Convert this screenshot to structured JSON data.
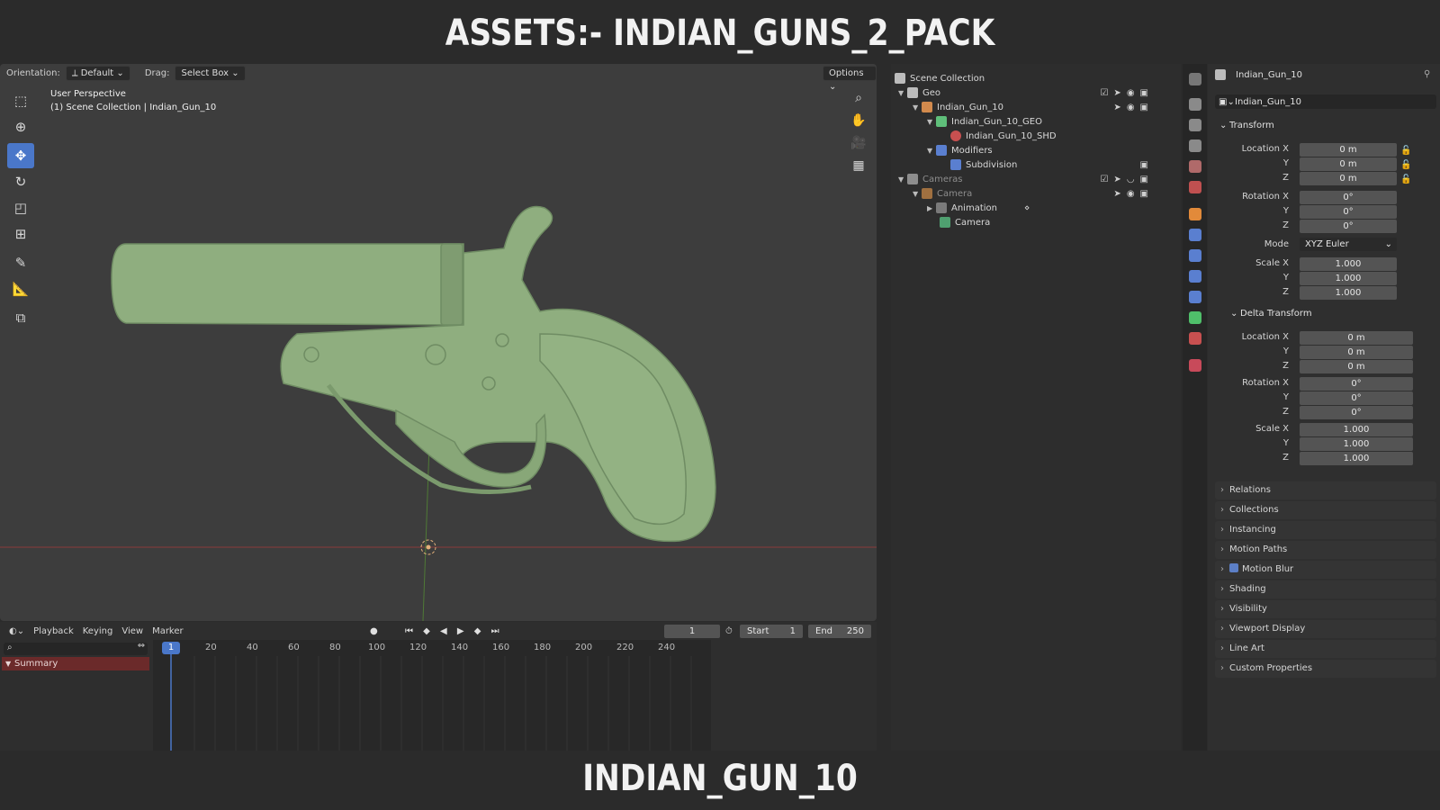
{
  "banner": {
    "top": "ASSETS:- INDIAN_GUNS_2_PACK",
    "bottom": "INDIAN_GUN_10"
  },
  "viewport": {
    "orientation_label": "Orientation:",
    "orientation_value": "Default",
    "drag_label": "Drag:",
    "drag_value": "Select Box",
    "options_label": "Options",
    "perspective": "User Perspective",
    "context": "(1) Scene Collection | Indian_Gun_10",
    "model_color": "#8fae7f"
  },
  "outliner": {
    "root": "Scene Collection",
    "rows": [
      {
        "label": "Geo"
      },
      {
        "label": "Indian_Gun_10"
      },
      {
        "label": "Indian_Gun_10_GEO"
      },
      {
        "label": "Indian_Gun_10_SHD"
      },
      {
        "label": "Modifiers"
      },
      {
        "label": "Subdivision"
      },
      {
        "label": "Cameras"
      },
      {
        "label": "Camera"
      },
      {
        "label": "Animation"
      },
      {
        "label": "Camera"
      }
    ]
  },
  "properties": {
    "object_name": "Indian_Gun_10",
    "datablock_name": "Indian_Gun_10",
    "transform": {
      "title": "Transform",
      "location_label": "Location X",
      "location": [
        "0 m",
        "0 m",
        "0 m"
      ],
      "rotation_label": "Rotation X",
      "rotation": [
        "0°",
        "0°",
        "0°"
      ],
      "mode_label": "Mode",
      "mode": "XYZ Euler",
      "scale_label": "Scale X",
      "scale": [
        "1.000",
        "1.000",
        "1.000"
      ],
      "y": "Y",
      "z": "Z"
    },
    "delta": {
      "title": "Delta Transform",
      "location_label": "Location X",
      "location": [
        "0 m",
        "0 m",
        "0 m"
      ],
      "rotation_label": "Rotation X",
      "rotation": [
        "0°",
        "0°",
        "0°"
      ],
      "scale_label": "Scale X",
      "scale": [
        "1.000",
        "1.000",
        "1.000"
      ]
    },
    "panels": [
      "Relations",
      "Collections",
      "Instancing",
      "Motion Paths",
      "Motion Blur",
      "Shading",
      "Visibility",
      "Viewport Display",
      "Line Art",
      "Custom Properties"
    ]
  },
  "timeline": {
    "menus": [
      "Playback",
      "Keying",
      "View",
      "Marker"
    ],
    "current_frame": "1",
    "start_label": "Start",
    "start": "1",
    "end_label": "End",
    "end": "250",
    "ticks": [
      "1",
      "20",
      "40",
      "60",
      "80",
      "100",
      "120",
      "140",
      "160",
      "180",
      "200",
      "220",
      "240"
    ],
    "summary": "Summary"
  }
}
